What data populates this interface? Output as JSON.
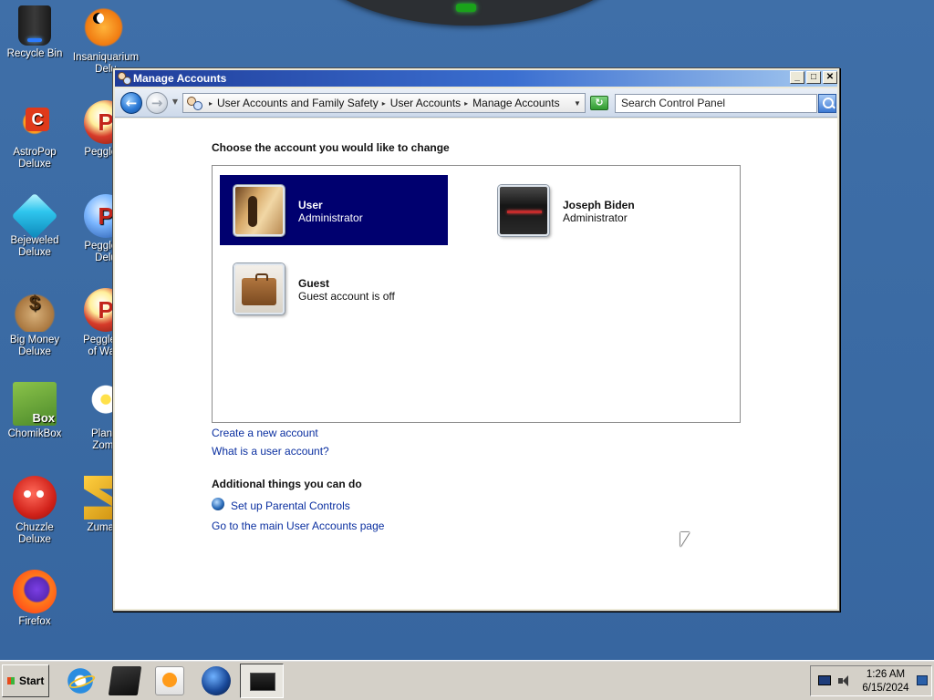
{
  "desktop": {
    "icons": [
      {
        "label": "Recycle Bin",
        "icon": "recycle-bin-icon"
      },
      {
        "label": "Insaniquarium\nDelu",
        "icon": "insaniquarium-icon"
      },
      {
        "label": "AstroPop\nDeluxe",
        "icon": "astropop-icon"
      },
      {
        "label": "Peggle D",
        "icon": "peggle-icon"
      },
      {
        "label": "Bejeweled\nDeluxe",
        "icon": "bejeweled-icon"
      },
      {
        "label": "Peggle N\nDelu",
        "icon": "peggle-nights-icon"
      },
      {
        "label": "Big Money\nDeluxe",
        "icon": "big-money-icon"
      },
      {
        "label": "Peggle W\nof Warc",
        "icon": "peggle-wow-icon"
      },
      {
        "label": "ChomikBox",
        "icon": "chomikbox-icon"
      },
      {
        "label": "Plants\nZomb",
        "icon": "plants-vs-zombies-icon"
      },
      {
        "label": "Chuzzle Deluxe",
        "icon": "chuzzle-icon"
      },
      {
        "label": "Zuma D",
        "icon": "zuma-icon"
      },
      {
        "label": "Firefox",
        "icon": "firefox-icon"
      }
    ]
  },
  "window": {
    "title": "Manage Accounts",
    "controls": {
      "minimize": "_",
      "maximize": "□",
      "close": "✕"
    }
  },
  "toolbar": {
    "back": "←",
    "forward": "→",
    "nav_dropdown": "▼",
    "breadcrumbs": [
      "User Accounts and Family Safety",
      "User Accounts",
      "Manage Accounts"
    ],
    "crumb_separator": "▸",
    "address_dropdown": "▼",
    "refresh": "↻",
    "search_placeholder": "Search Control Panel"
  },
  "main": {
    "heading": "Choose the account you would like to change",
    "accounts": [
      {
        "name": "User",
        "role": "Administrator",
        "selected": true,
        "picture": "guitar-picture"
      },
      {
        "name": "Joseph Biden",
        "role": "Administrator",
        "selected": false,
        "picture": "dark-device-picture"
      },
      {
        "name": "Guest",
        "role": "Guest account is off",
        "selected": false,
        "picture": "briefcase-picture"
      }
    ],
    "links": {
      "create": "Create a new account",
      "what_is": "What is a user account?"
    },
    "additional_heading": "Additional things you can do",
    "parental_controls": "Set up Parental Controls",
    "main_page": "Go to the main User Accounts page"
  },
  "taskbar": {
    "start_label": "Start",
    "apps": [
      "internet-explorer-icon",
      "box-app-icon",
      "media-player-icon",
      "globe-app-icon",
      "manage-accounts-window-icon"
    ],
    "clock_time": "1:26 AM",
    "clock_date": "6/15/2024"
  },
  "colors": {
    "selection": "#00006f",
    "link": "#0a2fa0",
    "desktop": "#3a6ea5"
  }
}
